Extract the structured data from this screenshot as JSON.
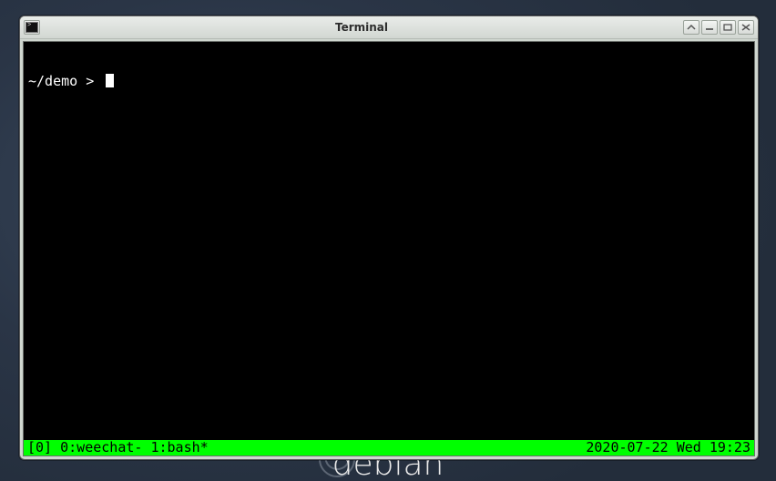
{
  "desktop": {
    "os_label": "debian"
  },
  "window": {
    "title": "Terminal"
  },
  "terminal": {
    "prompt": "~/demo > ",
    "status_left": "[0] 0:weechat- 1:bash*",
    "status_right": "2020-07-22 Wed 19:23"
  }
}
